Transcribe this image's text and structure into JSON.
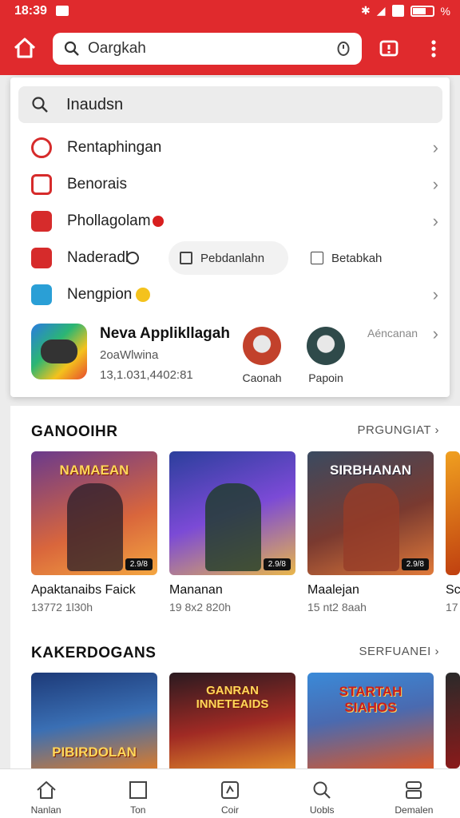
{
  "status": {
    "time": "18:39",
    "battery": "%"
  },
  "header": {
    "search_value": "Oargkah"
  },
  "dropdown": {
    "search_text": "Inaudsn",
    "rows": [
      {
        "label": "Rentaphingan",
        "icon": "refresh-icon"
      },
      {
        "label": "Benorais",
        "icon": "square-icon"
      },
      {
        "label": "Phollagolam",
        "icon": "gamepad-icon"
      },
      {
        "label": "Naderadl",
        "icon": "image-icon"
      },
      {
        "label": "Nengpion",
        "icon": "calendar-icon"
      }
    ],
    "pills": [
      {
        "label": "Pebdanlahn"
      },
      {
        "label": "Betabkah"
      }
    ],
    "featured": {
      "name": "Neva Applikllagah",
      "sub": "2oaWlwina",
      "stats": "13,1.031,4402:81",
      "more": "Aéncanan",
      "avatars": [
        {
          "label": "Caonah"
        },
        {
          "label": "Papoin"
        }
      ]
    }
  },
  "section1": {
    "title": "GANOOIHR",
    "more": "PRGUNGIAT",
    "cards": [
      {
        "title": "NAMAEAN",
        "name": "Apaktanaibs Faick",
        "meta": "13772 1l30h",
        "badge": "2.9/8"
      },
      {
        "title": "",
        "name": "Mananan",
        "meta": "19 8x2 820h",
        "badge": "2.9/8"
      },
      {
        "title": "SIRBHANAN",
        "name": "Maalejan",
        "meta": "15 nt2 8aah",
        "badge": "2.9/8"
      },
      {
        "title": "",
        "name": "Sc",
        "meta": "17",
        "badge": ""
      }
    ]
  },
  "section2": {
    "title": "KAKERDOGANS",
    "more": "SERFUANEI",
    "cards": [
      {
        "title": "PIBIRDOLAN"
      },
      {
        "title": "GANRAN INNETEAIDS"
      },
      {
        "title": "STARTAH SIAHOS"
      },
      {
        "title": ""
      }
    ]
  },
  "nav": [
    {
      "label": "Nanlan",
      "icon": "home-icon"
    },
    {
      "label": "Ton",
      "icon": "square-icon"
    },
    {
      "label": "Coir",
      "icon": "gamepad-icon"
    },
    {
      "label": "Uobls",
      "icon": "search-icon"
    },
    {
      "label": "Demalen",
      "icon": "profile-icon"
    }
  ]
}
